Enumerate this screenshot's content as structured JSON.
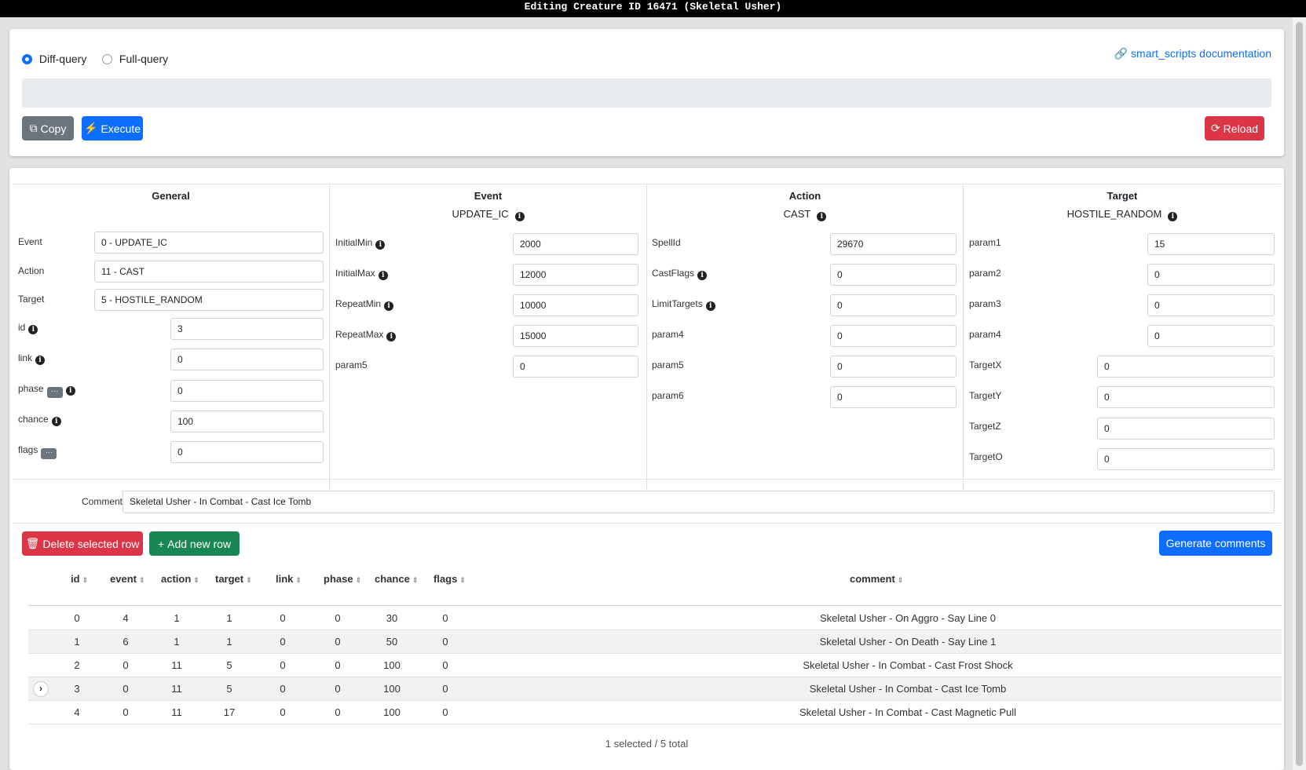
{
  "window": {
    "title": "Editing Creature ID 16471 (Skeletal Usher)"
  },
  "query": {
    "diff_label": "Diff-query",
    "full_label": "Full-query",
    "selected": "Diff-query",
    "doc_link": "smart_scripts documentation",
    "copy_label": "Copy",
    "execute_label": "Execute",
    "reload_label": "Reload"
  },
  "general": {
    "title": "General",
    "event_label": "Event",
    "event_value": "0 - UPDATE_IC",
    "action_label": "Action",
    "action_value": "11 - CAST",
    "target_label": "Target",
    "target_value": "5 - HOSTILE_RANDOM",
    "id_label": "id",
    "id_value": "3",
    "link_label": "link",
    "link_value": "0",
    "phase_label": "phase",
    "phase_value": "0",
    "chance_label": "chance",
    "chance_value": "100",
    "flags_label": "flags",
    "flags_value": "0",
    "dots": "···"
  },
  "event": {
    "title": "Event",
    "subtitle": "UPDATE_IC",
    "p1_label": "InitialMin",
    "p1_value": "2000",
    "p2_label": "InitialMax",
    "p2_value": "12000",
    "p3_label": "RepeatMin",
    "p3_value": "10000",
    "p4_label": "RepeatMax",
    "p4_value": "15000",
    "p5_label": "param5",
    "p5_value": "0"
  },
  "action": {
    "title": "Action",
    "subtitle": "CAST",
    "p1_label": "SpellId",
    "p1_value": "29670",
    "p2_label": "CastFlags",
    "p2_value": "0",
    "p3_label": "LimitTargets",
    "p3_value": "0",
    "p4_label": "param4",
    "p4_value": "0",
    "p5_label": "param5",
    "p5_value": "0",
    "p6_label": "param6",
    "p6_value": "0"
  },
  "target": {
    "title": "Target",
    "subtitle": "HOSTILE_RANDOM",
    "p1_label": "param1",
    "p1_value": "15",
    "p2_label": "param2",
    "p2_value": "0",
    "p3_label": "param3",
    "p3_value": "0",
    "p4_label": "param4",
    "p4_value": "0",
    "x_label": "TargetX",
    "x_value": "0",
    "y_label": "TargetY",
    "y_value": "0",
    "z_label": "TargetZ",
    "z_value": "0",
    "o_label": "TargetO",
    "o_value": "0"
  },
  "comment": {
    "label": "Comment",
    "value": "Skeletal Usher - In Combat - Cast Ice Tomb"
  },
  "table_actions": {
    "delete_label": "Delete selected row",
    "add_label": "Add new row",
    "generate_label": "Generate comments"
  },
  "table": {
    "headers": {
      "id": "id",
      "event": "event",
      "action": "action",
      "target": "target",
      "link": "link",
      "phase": "phase",
      "chance": "chance",
      "flags": "flags",
      "comment": "comment"
    },
    "rows": [
      {
        "id": "0",
        "event": "4",
        "action": "1",
        "target": "1",
        "link": "0",
        "phase": "0",
        "chance": "30",
        "flags": "0",
        "comment": "Skeletal Usher - On Aggro - Say Line 0"
      },
      {
        "id": "1",
        "event": "6",
        "action": "1",
        "target": "1",
        "link": "0",
        "phase": "0",
        "chance": "50",
        "flags": "0",
        "comment": "Skeletal Usher - On Death - Say Line 1"
      },
      {
        "id": "2",
        "event": "0",
        "action": "11",
        "target": "5",
        "link": "0",
        "phase": "0",
        "chance": "100",
        "flags": "0",
        "comment": "Skeletal Usher - In Combat - Cast Frost Shock"
      },
      {
        "id": "3",
        "event": "0",
        "action": "11",
        "target": "5",
        "link": "0",
        "phase": "0",
        "chance": "100",
        "flags": "0",
        "comment": "Skeletal Usher - In Combat - Cast Ice Tomb"
      },
      {
        "id": "4",
        "event": "0",
        "action": "11",
        "target": "17",
        "link": "0",
        "phase": "0",
        "chance": "100",
        "flags": "0",
        "comment": "Skeletal Usher - In Combat - Cast Magnetic Pull"
      }
    ],
    "footer": "1 selected / 5 total"
  },
  "colors": {
    "primary": "#0d6efd",
    "danger": "#dc3545",
    "success": "#198754",
    "secondary": "#6c757d"
  }
}
